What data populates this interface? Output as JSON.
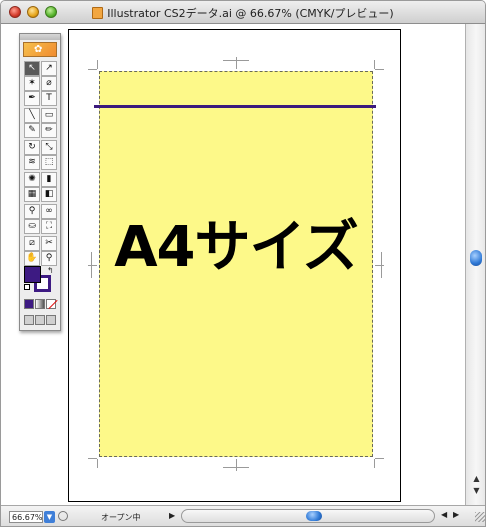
{
  "window": {
    "title": "Illustrator CS2データ.ai @ 66.67% (CMYK/プレビュー)"
  },
  "document": {
    "headline": "A4サイズ",
    "page_fill_color": "#fdf989",
    "accent_bar_color": "#3b1a7d"
  },
  "status": {
    "zoom": "66.67%",
    "state_text": "オープン中"
  },
  "toolbox": {
    "tools": [
      {
        "name": "selection-tool",
        "glyph": "↖"
      },
      {
        "name": "direct-selection-tool",
        "glyph": "↗"
      },
      {
        "name": "magic-wand-tool",
        "glyph": "✶"
      },
      {
        "name": "lasso-tool",
        "glyph": "⌀"
      },
      {
        "name": "pen-tool",
        "glyph": "✒"
      },
      {
        "name": "type-tool",
        "glyph": "T"
      },
      {
        "name": "line-segment-tool",
        "glyph": "╲"
      },
      {
        "name": "rectangle-tool",
        "glyph": "▭"
      },
      {
        "name": "paintbrush-tool",
        "glyph": "✎"
      },
      {
        "name": "pencil-tool",
        "glyph": "✏"
      },
      {
        "name": "rotate-tool",
        "glyph": "↻"
      },
      {
        "name": "scale-tool",
        "glyph": "⤡"
      },
      {
        "name": "warp-tool",
        "glyph": "≋"
      },
      {
        "name": "free-transform-tool",
        "glyph": "⬚"
      },
      {
        "name": "symbol-sprayer-tool",
        "glyph": "✺"
      },
      {
        "name": "column-graph-tool",
        "glyph": "▮"
      },
      {
        "name": "mesh-tool",
        "glyph": "▦"
      },
      {
        "name": "gradient-tool",
        "glyph": "◧"
      },
      {
        "name": "eyedropper-tool",
        "glyph": "⚲"
      },
      {
        "name": "blend-tool",
        "glyph": "∞"
      },
      {
        "name": "live-paint-bucket-tool",
        "glyph": "⛀"
      },
      {
        "name": "live-paint-selection-tool",
        "glyph": "⛶"
      },
      {
        "name": "slice-tool",
        "glyph": "⧄"
      },
      {
        "name": "scissors-tool",
        "glyph": "✂"
      },
      {
        "name": "hand-tool",
        "glyph": "✋"
      },
      {
        "name": "zoom-tool",
        "glyph": "⚲"
      }
    ],
    "fill_color": "#3d1a82",
    "stroke_color": "#3d1a82"
  }
}
